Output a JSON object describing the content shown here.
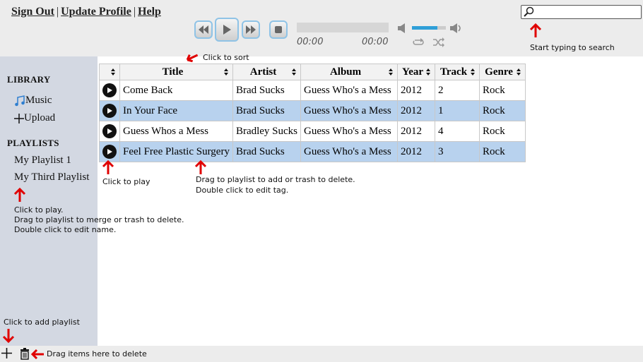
{
  "topnav": {
    "sign_out": "Sign Out",
    "sep": "|",
    "update_profile": "Update Profile",
    "help": "Help"
  },
  "player": {
    "elapsed": "00:00",
    "duration": "00:00",
    "volume_percent": 75,
    "seek_percent": 0
  },
  "search": {
    "value": "",
    "placeholder": "",
    "icon": "magnifier-icon"
  },
  "annotations": {
    "sort": "Click to sort",
    "search": "Start typing to search",
    "play": "Click to play",
    "drag_track_1": "Drag to playlist to add or trash to delete.",
    "drag_track_2": "Double click to edit tag.",
    "playlist_1": "Click to play.",
    "playlist_2": "Drag to playlist to merge or trash to delete.",
    "playlist_3": "Double click to edit name.",
    "add_playlist": "Click to add playlist",
    "trash": "Drag items here to delete"
  },
  "sidebar": {
    "library_heading": "LIBRARY",
    "music": "Music",
    "upload": "Upload",
    "playlists_heading": "PLAYLISTS",
    "playlists": [
      "My Playlist 1",
      "My Third Playlist"
    ]
  },
  "table": {
    "columns": [
      "Title",
      "Artist",
      "Album",
      "Year",
      "Track",
      "Genre"
    ],
    "rows": [
      [
        "Come Back",
        "Brad Sucks",
        "Guess Who's a Mess",
        "2012",
        "2",
        "Rock"
      ],
      [
        "In Your Face",
        "Brad Sucks",
        "Guess Who's a Mess",
        "2012",
        "1",
        "Rock"
      ],
      [
        "Guess Whos a Mess",
        "Bradley Sucks",
        "Guess Who's a Mess",
        "2012",
        "4",
        "Rock"
      ],
      [
        "Feel Free Plastic Surgery",
        "Brad Sucks",
        "Guess Who's a Mess",
        "2012",
        "3",
        "Rock"
      ]
    ]
  },
  "colors": {
    "accent": "#2f9fd8",
    "row_highlight": "#b8d2ee",
    "sidebar": "#d3d8e2",
    "arrow": "#e00000"
  }
}
